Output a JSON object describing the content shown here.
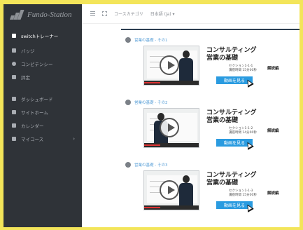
{
  "app": {
    "logo_text": "Fundo-Station"
  },
  "sidebar": {
    "items": [
      {
        "label": "switchトレーナー",
        "icon": "square-icon",
        "active": true
      },
      {
        "label": "バッジ",
        "icon": "bookmark-icon"
      },
      {
        "label": "コンピテンシー",
        "icon": "gear-icon"
      },
      {
        "label": "評定",
        "icon": "star-icon"
      },
      {
        "label": "ダッシュボード",
        "icon": "dashboard-icon"
      },
      {
        "label": "サイトホーム",
        "icon": "home-icon"
      },
      {
        "label": "カレンダー",
        "icon": "calendar-icon"
      },
      {
        "label": "マイコース",
        "icon": "folder-icon",
        "chevron": "›"
      }
    ]
  },
  "topbar": {
    "menu_label": "コースカテゴリ",
    "language_label": "日本語 (ja) ▾"
  },
  "sections": [
    {
      "heading": "営業の基礎 - その1",
      "title_line1": "コンサルティング",
      "title_line2": "営業の基礎",
      "meta_line1": "セクション1-1-1",
      "meta_line2": "講座時間 15分00秒",
      "tag": "解説編",
      "button": "動画を見る"
    },
    {
      "heading": "営業の基礎 - その2",
      "title_line1": "コンサルティング",
      "title_line2": "営業の基礎",
      "meta_line1": "セクション1-1-2",
      "meta_line2": "講座時間 14分00秒",
      "tag": "解説編",
      "button": "動画を見る"
    },
    {
      "heading": "営業の基礎 - その3",
      "title_line1": "コンサルティング",
      "title_line2": "営業の基礎",
      "meta_line1": "セクション1-1-3",
      "meta_line2": "講座時間 15分00秒",
      "tag": "解説編",
      "button": "動画を見る"
    }
  ],
  "colors": {
    "sidebar_bg": "#2f3338",
    "accent": "#2a9be0",
    "frame_bg": "#f3e55a"
  }
}
